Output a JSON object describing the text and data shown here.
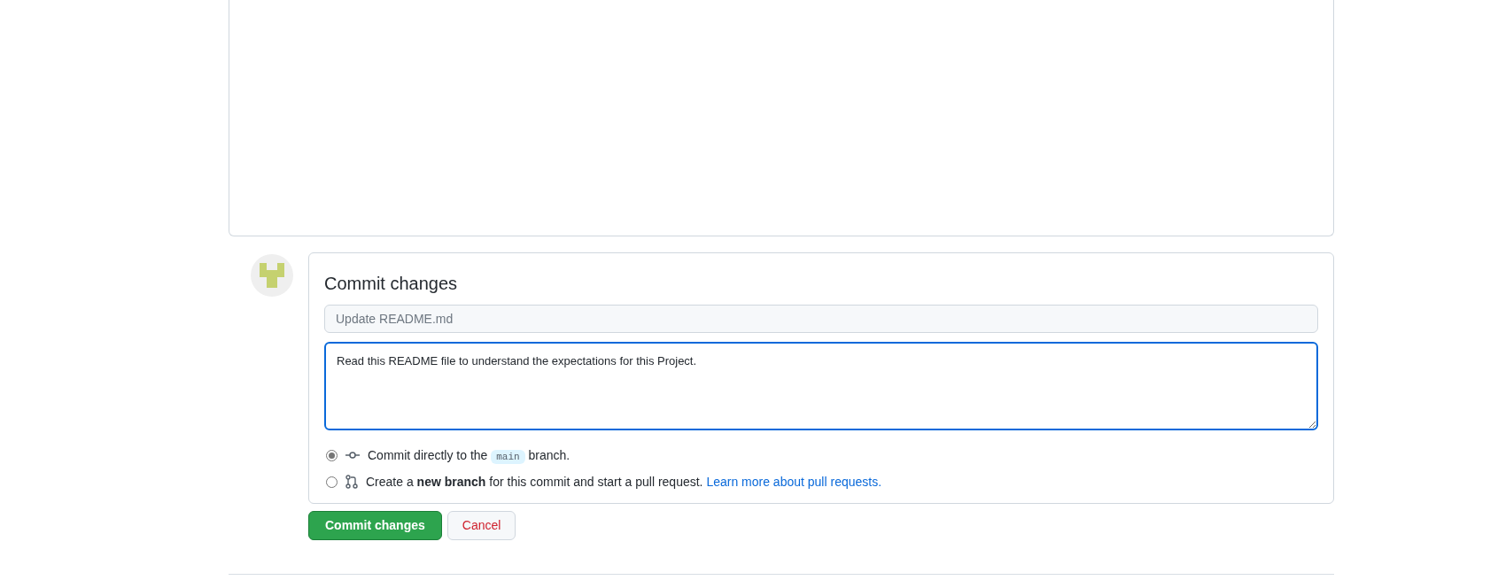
{
  "commit_form": {
    "title": "Commit changes",
    "summary": {
      "placeholder": "Update README.md"
    },
    "description": {
      "value": "Read this README file to understand the expectations for this Project."
    },
    "options": [
      {
        "kind": "direct",
        "selected": true,
        "text_before": "Commit directly to the",
        "branch": "main",
        "text_after": "branch."
      },
      {
        "kind": "pull_request",
        "selected": false,
        "text": "Create a **new branch** for this commit and start a pull request.",
        "link": "Learn more about pull requests."
      }
    ],
    "buttons": {
      "commit": "Commit changes",
      "cancel": "Cancel"
    }
  }
}
